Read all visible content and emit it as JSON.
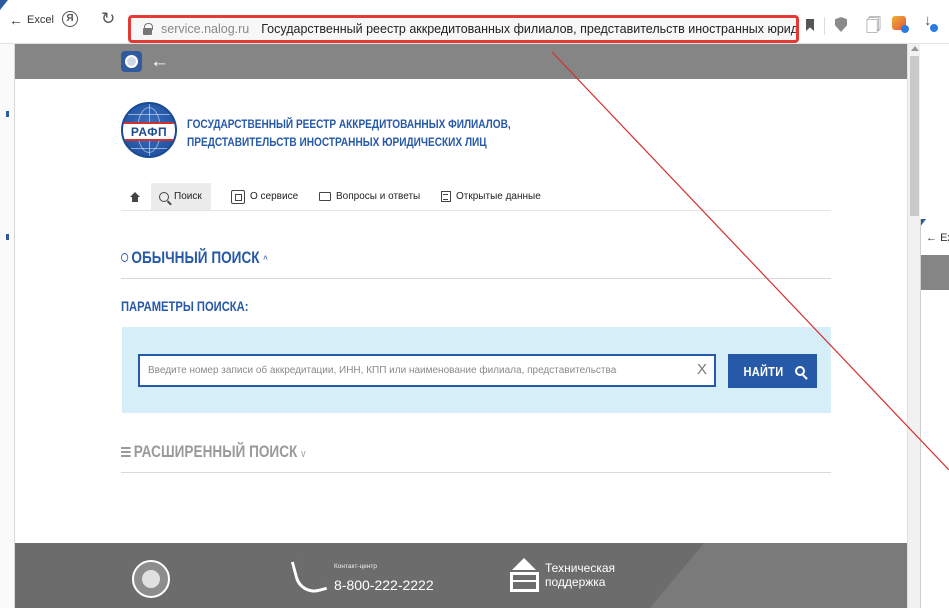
{
  "browser": {
    "back_label": "Excel",
    "domain": "service.nalog.ru",
    "tab_title": "Государственный реестр аккредитованных филиалов, представительств иностранных юридических..."
  },
  "header": {
    "logo_text": "РАФП",
    "title_line1": "ГОСУДАРСТВЕННЫЙ РЕЕСТР АККРЕДИТОВАННЫХ ФИЛИАЛОВ,",
    "title_line2": "ПРЕДСТАВИТЕЛЬСТВ ИНОСТРАННЫХ ЮРИДИЧЕСКИХ ЛИЦ"
  },
  "nav": {
    "items": [
      {
        "label": "Поиск",
        "icon": "search-icon",
        "active": true
      },
      {
        "label": "О сервисе",
        "icon": "about-icon"
      },
      {
        "label": "Вопросы и ответы",
        "icon": "chat-icon"
      },
      {
        "label": "Открытые данные",
        "icon": "data-icon"
      }
    ]
  },
  "search": {
    "simple_title": "ОБЫЧНЫЙ ПОИСК",
    "simple_chevron": "^",
    "params_title": "ПАРАМЕТРЫ ПОИСКА:",
    "placeholder": "Введите номер записи об аккредитации, ИНН, КПП или наименование филиала, представительства",
    "clear_glyph": "X",
    "button_label": "НАЙТИ",
    "advanced_title": "РАСШИРЕННЫЙ ПОИСК",
    "advanced_chevron": "v"
  },
  "footer": {
    "contact_label": "Контакт-центр",
    "phone": "8-800-222-2222",
    "support_line1": "Техническая",
    "support_line2": "поддержка"
  },
  "second_window": {
    "back_label": "Excel"
  },
  "colors": {
    "brand_blue": "#2659a8",
    "header_gray": "#858585",
    "footer_gray": "#6c6c6c",
    "search_panel": "#d6eef8",
    "highlight_red": "#e53935"
  }
}
